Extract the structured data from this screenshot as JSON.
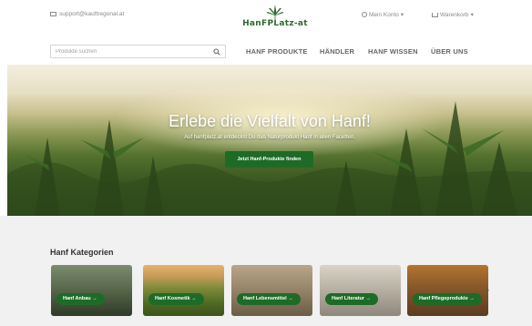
{
  "header": {
    "support_email": "support@kauftregonal.at",
    "logo_text": "HanFPLatz-at",
    "account_label": "Mein Konto",
    "account_caret": "▾",
    "cart_label": "Warenkorb",
    "cart_caret": "▾"
  },
  "search": {
    "placeholder": "Produkte suchen"
  },
  "nav": {
    "items": [
      {
        "label": "HANF PRODUKTE"
      },
      {
        "label": "HÄNDLER"
      },
      {
        "label": "HANF WISSEN"
      },
      {
        "label": "ÜBER UNS"
      }
    ]
  },
  "hero": {
    "title": "Erlebe die Vielfalt von Hanf!",
    "subtitle": "Auf hanfplatz.at entdeckst Du das Naturprodukt Hanf in allen Facetten.",
    "button_label": "Jetzt Hanf-Produkte finden"
  },
  "categories": {
    "title": "Hanf Kategorien",
    "next_arrow": "›",
    "items": [
      {
        "label": "Hanf Anbau",
        "arrow": "→"
      },
      {
        "label": "Hanf Kosmetik",
        "arrow": "→"
      },
      {
        "label": "Hanf Lebensmittel",
        "arrow": "→"
      },
      {
        "label": "Hanf Literatur",
        "arrow": "→"
      },
      {
        "label": "Hanf Pflegeprodukte",
        "arrow": "→"
      }
    ]
  },
  "colors": {
    "brand_green": "#1e6b27",
    "logo_green": "#2d6b2d",
    "nav_text": "#666666",
    "section_bg": "#f1f1f1"
  }
}
